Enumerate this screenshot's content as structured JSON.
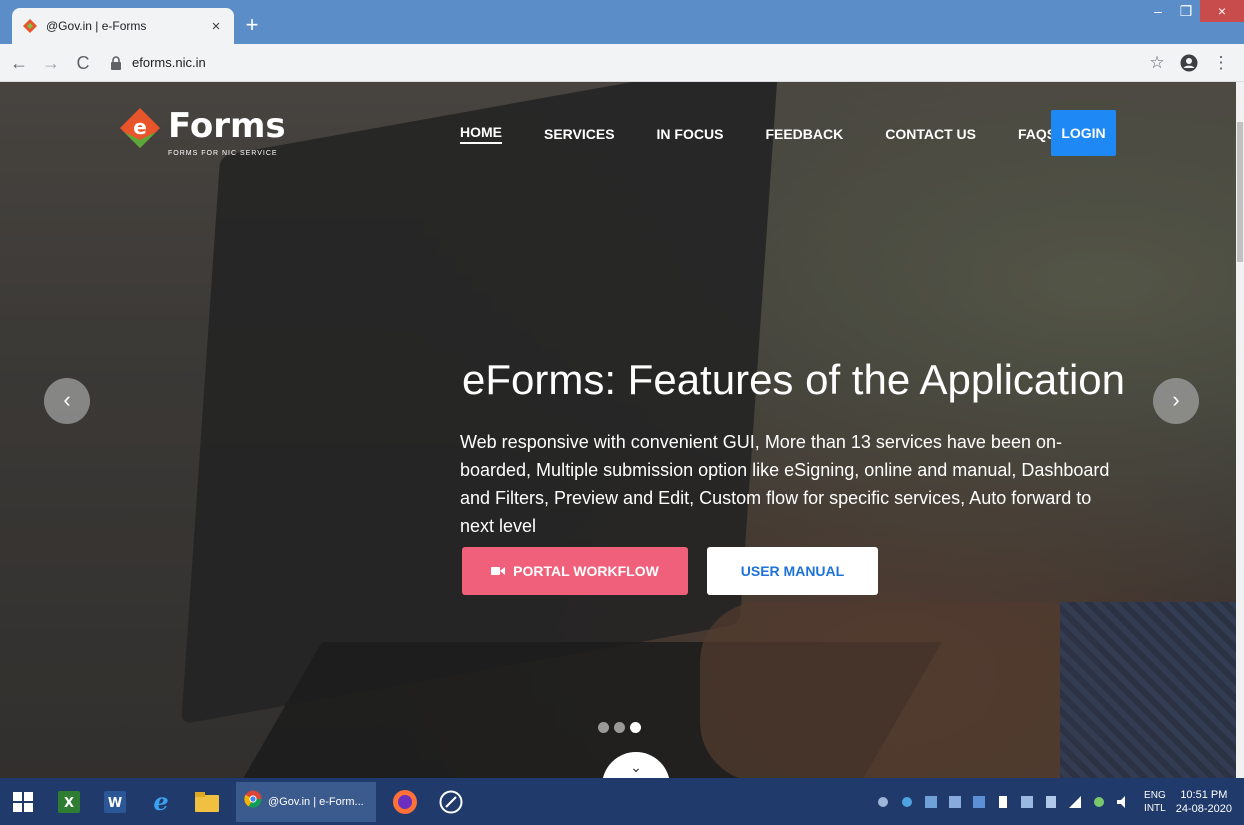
{
  "browser": {
    "tab_title": "@Gov.in | e-Forms",
    "tab_close": "×",
    "new_tab": "+",
    "url": "eforms.nic.in",
    "window_controls": [
      "–",
      "❐",
      "×"
    ]
  },
  "site": {
    "logo_word": "Forms",
    "logo_tagline": "FORMS FOR NIC SERVICE",
    "nav": [
      "HOME",
      "SERVICES",
      "IN FOCUS",
      "FEEDBACK",
      "CONTACT US",
      "FAQS"
    ],
    "login": "LOGIN"
  },
  "hero": {
    "title": "eForms: Features of the Application",
    "description": "Web responsive with convenient GUI, More than 13 services have been on-boarded, Multiple submission option like eSigning, online and manual, Dashboard and Filters, Preview and Edit, Custom flow for specific services, Auto forward to next level",
    "btn_workflow": "PORTAL WORKFLOW",
    "btn_manual": "USER MANUAL",
    "slide_count": 3,
    "active_slide": 3
  },
  "taskbar": {
    "chrome_label": "@Gov.in | e-Form...",
    "lang_top": "ENG",
    "lang_bottom": "INTL",
    "time": "10:51 PM",
    "date": "24-08-2020"
  },
  "colors": {
    "login_blue": "#1e88f5",
    "workflow_pink": "#f0607a",
    "manual_text": "#1e73d8",
    "taskbar": "#1f3a6b"
  },
  "icons": [
    "favicon-icon",
    "back-icon",
    "forward-icon",
    "reload-icon",
    "lock-icon",
    "star-icon",
    "profile-icon",
    "menu-icon",
    "camera-icon",
    "chevron-left-icon",
    "chevron-right-icon",
    "chevron-down-icon",
    "windows-start-icon"
  ]
}
